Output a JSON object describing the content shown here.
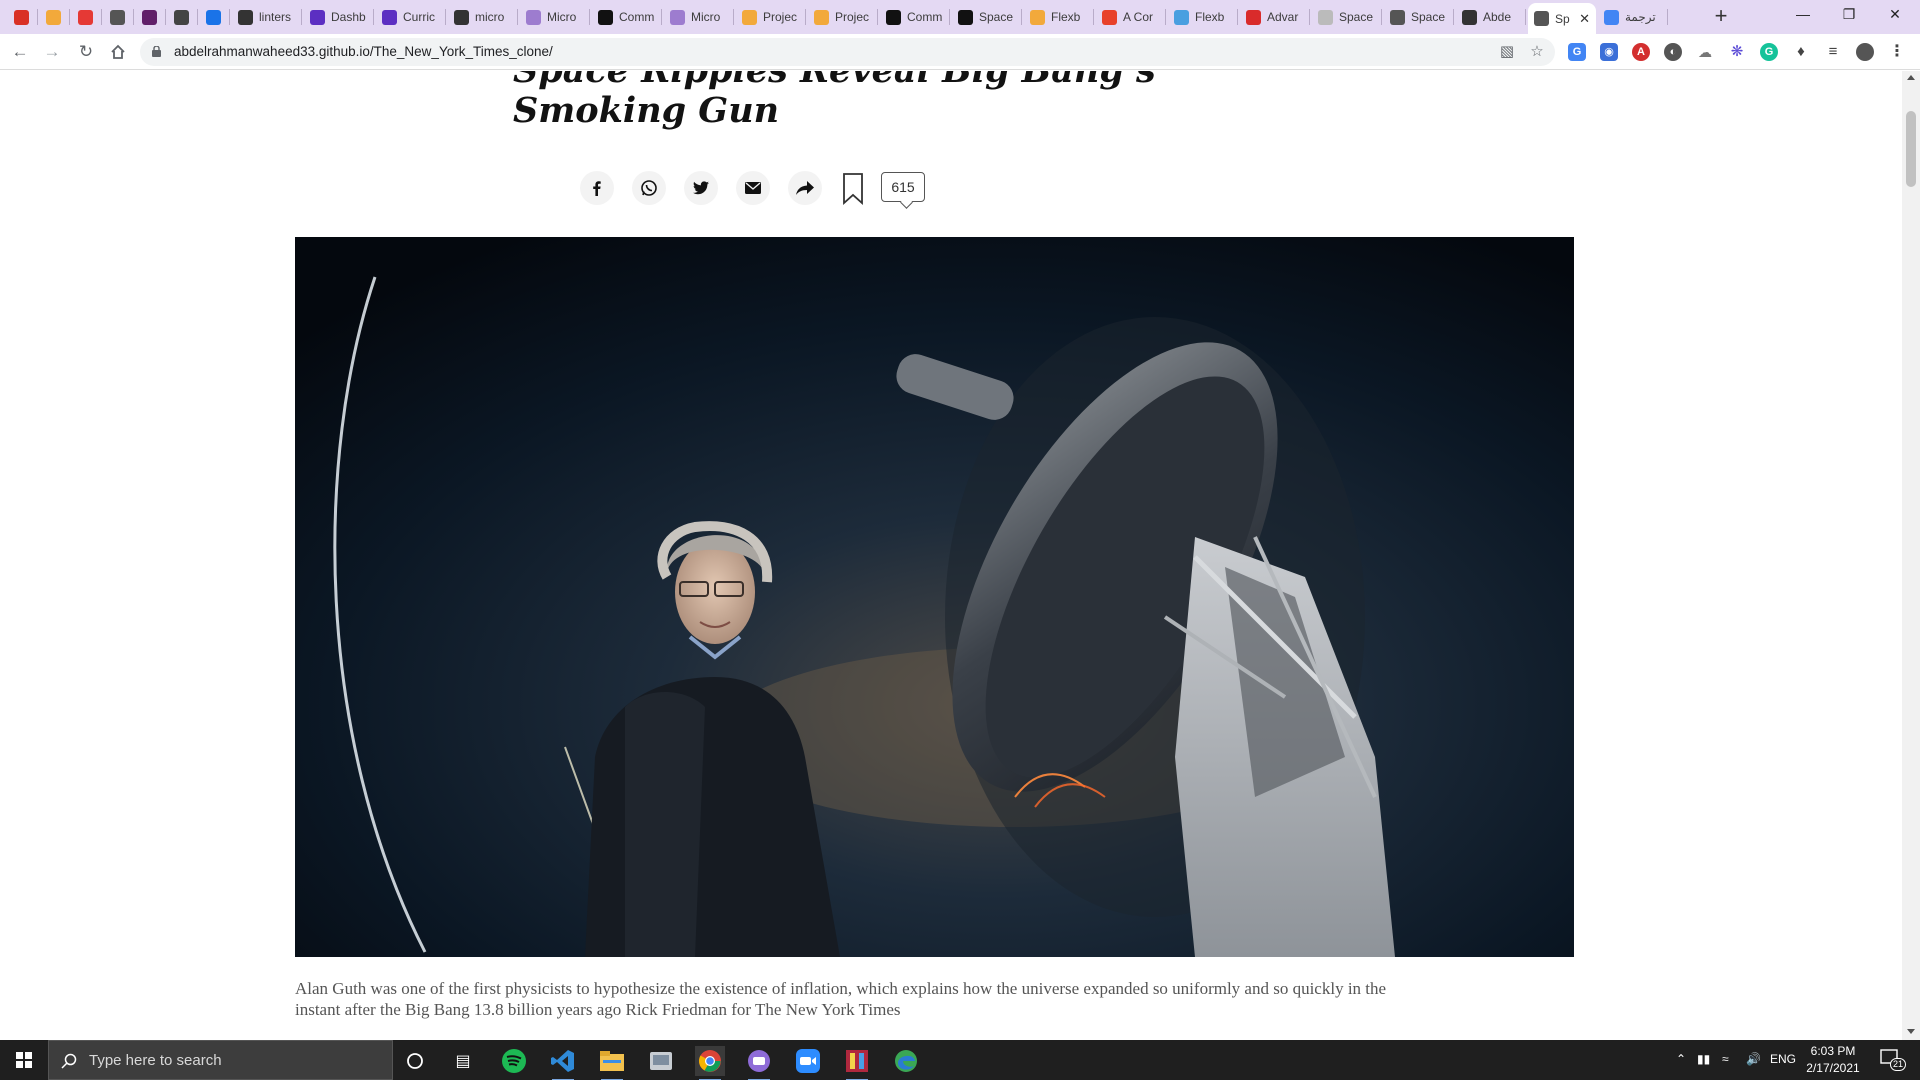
{
  "browser": {
    "tabs": [
      {
        "label": "",
        "favicon": "gmail-icon",
        "color": "#d93025"
      },
      {
        "label": "",
        "favicon": "bookmark-icon",
        "color": "#f2a93b"
      },
      {
        "label": "",
        "favicon": "tomato-icon",
        "color": "#e53935"
      },
      {
        "label": "",
        "favicon": "globe-icon",
        "color": "#555555"
      },
      {
        "label": "",
        "favicon": "slack-icon",
        "color": "#611f69"
      },
      {
        "label": "",
        "favicon": "speaker-icon",
        "color": "#444444"
      },
      {
        "label": "",
        "favicon": "refresh-icon",
        "color": "#1a73e8"
      },
      {
        "label": "linters",
        "favicon": "github-icon",
        "color": "#333333"
      },
      {
        "label": "Dashb",
        "favicon": "microverse-icon",
        "color": "#5c2fc2"
      },
      {
        "label": "Curric",
        "favicon": "microverse-icon",
        "color": "#5c2fc2"
      },
      {
        "label": "micro",
        "favicon": "github-icon",
        "color": "#333333"
      },
      {
        "label": "Micro",
        "favicon": "microverse-icon",
        "color": "#9d7ccf"
      },
      {
        "label": "Comm",
        "favicon": "vercel-icon",
        "color": "#111111"
      },
      {
        "label": "Micro",
        "favicon": "microverse-icon",
        "color": "#9d7ccf"
      },
      {
        "label": "Projec",
        "favicon": "bookmark-icon",
        "color": "#f2a93b"
      },
      {
        "label": "Projec",
        "favicon": "bookmark-icon",
        "color": "#f2a93b"
      },
      {
        "label": "Comm",
        "favicon": "vercel-icon",
        "color": "#111111"
      },
      {
        "label": "Space",
        "favicon": "nyt-icon",
        "color": "#111111"
      },
      {
        "label": "Flexb",
        "favicon": "bookmark-icon",
        "color": "#f2a93b"
      },
      {
        "label": "A Cor",
        "favicon": "asterisk-icon",
        "color": "#e8412a"
      },
      {
        "label": "Flexb",
        "favicon": "flexbox-icon",
        "color": "#4a9fe0"
      },
      {
        "label": "Advar",
        "favicon": "advanced-icon",
        "color": "#d92b2b"
      },
      {
        "label": "Space",
        "favicon": "page-icon",
        "color": "#bbbbbb"
      },
      {
        "label": "Space",
        "favicon": "globe-icon",
        "color": "#555555"
      },
      {
        "label": "Abde",
        "favicon": "github-icon",
        "color": "#333333"
      },
      {
        "label": "Sp",
        "favicon": "globe-icon",
        "color": "#555555",
        "active": true
      },
      {
        "label": "ترجمة",
        "favicon": "translate-icon",
        "color": "#4285f4"
      }
    ],
    "url": "abdelrahmanwaheed33.github.io/The_New_York_Times_clone/"
  },
  "article": {
    "headline_line1": "Space Ripples Reveal Big Bang’s",
    "headline_line2": "Smoking Gun",
    "comment_count": "615",
    "caption": "Alan Guth was one of the first physicists to hypothesize the existence of inflation, which explains how the universe expanded so uniformly and so quickly in the instant after the Big Bang 13.8 billion years ago Rick Friedman for The New York Times"
  },
  "taskbar": {
    "search_placeholder": "Type here to search",
    "language": "ENG",
    "time": "6:03 PM",
    "date": "2/17/2021",
    "notification_count": "21"
  }
}
